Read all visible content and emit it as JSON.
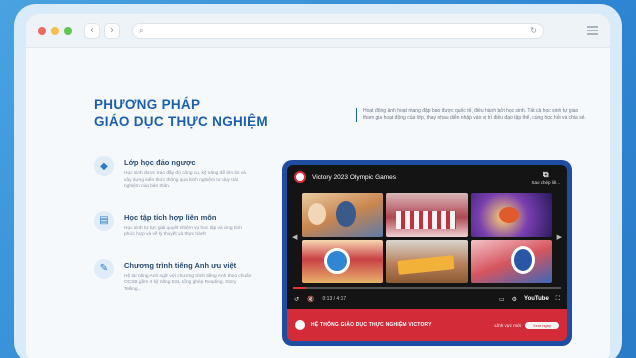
{
  "window": {
    "traffic_colors": [
      "#ec6a5e",
      "#f4bf4f",
      "#61c554"
    ]
  },
  "addressbar": {
    "text": "",
    "nav_back": "‹",
    "nav_forward": "›",
    "search_icon": "search-icon",
    "reload_icon": "reload-icon"
  },
  "heading": {
    "line1": "PHƯƠNG PHÁP",
    "line2": "GIÁO DỤC THỰC NGHIỆM"
  },
  "intro": "Hoạt động ảnh hoạt mang đặp bao được quốc tế, điều hành bởi học sinh. Tất cả học sinh tự giao tham gia hoạt động của lớp, thay nhau diễn nhập vào vị trí điều đạo tập thể, cùng học hỏi và chia sẻ.",
  "features": [
    {
      "icon": "flip-classroom-icon",
      "title": "Lớp học đảo ngược",
      "desc": "Học sinh được trao đầy đủ công cụ, kỹ năng để tìm tòi và xây dựng kiến thức thông qua kinh nghiệm tư duy trải nghiệm của bản thân."
    },
    {
      "icon": "integrated-learning-icon",
      "title": "Học tập tích hợp liên môn",
      "desc": "Học sinh tự lực giải quyết nhiệm vụ học tập và ứng tính phức hợp và về lý thuyết và thực hành"
    },
    {
      "icon": "english-program-icon",
      "title": "Chương trình tiếng Anh ưu việt",
      "desc": "Hệ tài năng Anh ngữ với chương trình tiếng Anh theo chuẩn OCSB gồm 4 kỹ năng ESL tổng ghép Reading, Story Telling..."
    }
  ],
  "player": {
    "title": "Victory 2023 Olympic Games",
    "share_label": "Sao chép liê...",
    "time": "0:13 / 4:17",
    "progress": 0.05,
    "youtube_label": "YouTube",
    "caption_title": "HỆ THỐNG GIÁO DỤC THỰC NGHIỆM VICTORY",
    "caption_right": "Lĩnh vực mới",
    "caption_pill": "Xem ngay"
  }
}
